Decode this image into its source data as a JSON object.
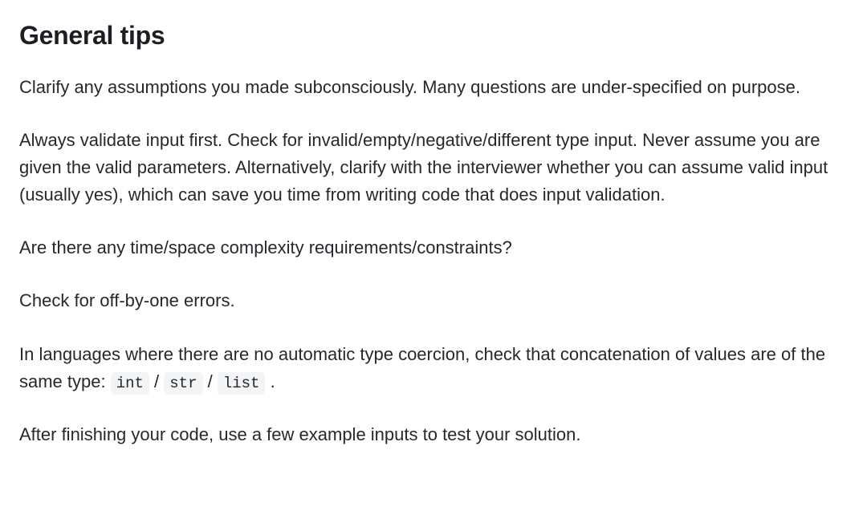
{
  "heading": "General tips",
  "paragraphs": {
    "p1": "Clarify any assumptions you made subconsciously. Many questions are under-specified on purpose.",
    "p2": "Always validate input first. Check for invalid/empty/negative/different type input. Never assume you are given the valid parameters. Alternatively, clarify with the interviewer whether you can assume valid input (usually yes), which can save you time from writing code that does input validation.",
    "p3": "Are there any time/space complexity requirements/constraints?",
    "p4": "Check for off-by-one errors.",
    "p5_before": "In languages where there are no automatic type coercion, check that concatenation of values are of the same type: ",
    "p5_code1": "int",
    "p5_sep1": " / ",
    "p5_code2": "str",
    "p5_sep2": " / ",
    "p5_code3": "list",
    "p5_after": " .",
    "p6": "After finishing your code, use a few example inputs to test your solution."
  }
}
